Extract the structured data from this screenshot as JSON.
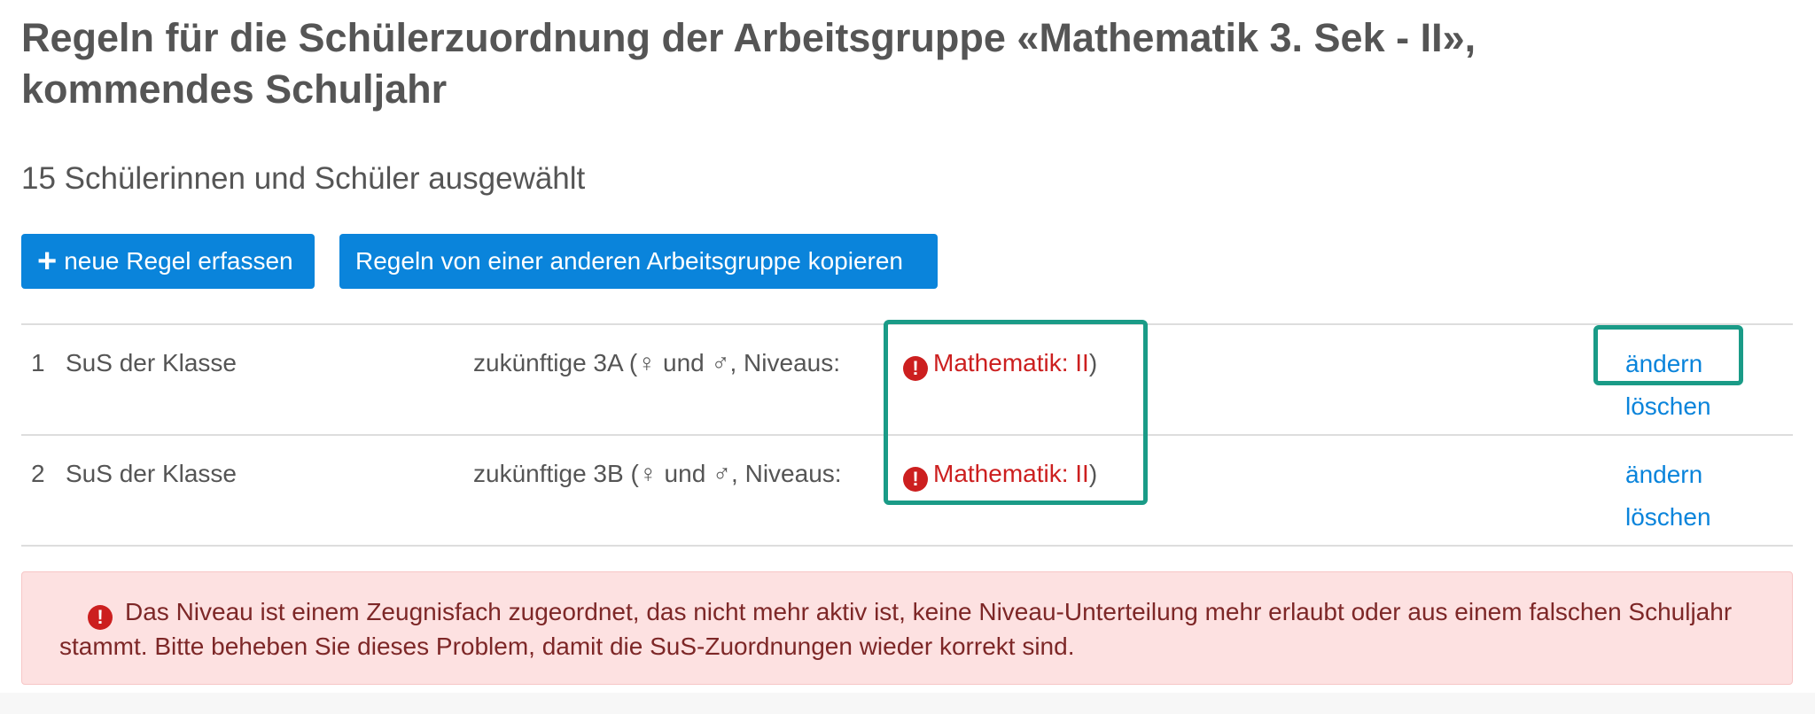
{
  "header": {
    "title": "Regeln für die Schülerzuordnung der Arbeitsgruppe «Mathematik 3. Sek - II», kommendes Schuljahr",
    "selection_summary": "15 Schülerinnen und Schüler ausgewählt"
  },
  "toolbar": {
    "new_rule_icon": "+",
    "new_rule_label": "neue Regel erfassen",
    "copy_rules_label": "Regeln von einer anderen Arbeitsgruppe kopieren"
  },
  "rules": [
    {
      "number": "1",
      "type": "SuS der Klasse",
      "description": "zukünftige 3A (♀ und ♂, Niveaus:",
      "error_icon": "exclamation-circle-icon",
      "error_label": "Mathematik: II",
      "closing": ")",
      "edit_label": "ändern",
      "delete_label": "löschen"
    },
    {
      "number": "2",
      "type": "SuS der Klasse",
      "description": "zukünftige 3B (♀ und ♂, Niveaus:",
      "error_icon": "exclamation-circle-icon",
      "error_label": "Mathematik: II",
      "closing": ")",
      "edit_label": "ändern",
      "delete_label": "löschen"
    }
  ],
  "alert": {
    "icon": "exclamation-circle-icon",
    "message": "Das Niveau ist einem Zeugnisfach zugeordnet, das nicht mehr aktiv ist, keine Niveau-Unterteilung mehr erlaubt oder aus einem falschen Schuljahr stammt. Bitte beheben Sie dieses Problem, damit die SuS-Zuordnungen wieder korrekt sind."
  },
  "colors": {
    "primary": "#0a84db",
    "error": "#cc1f1f",
    "highlight": "#1a9b87",
    "alert_background": "#fde1e1"
  }
}
